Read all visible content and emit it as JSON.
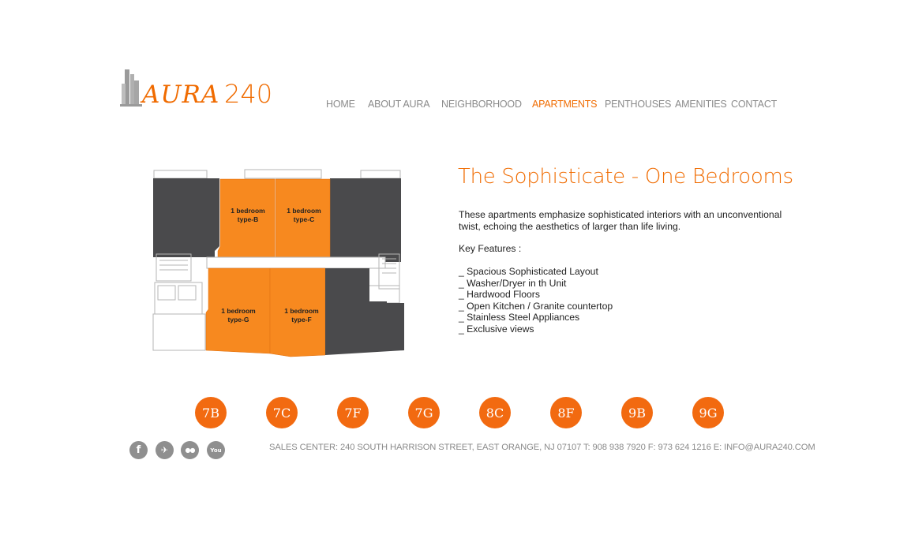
{
  "brand": {
    "logo_word": "AURA",
    "logo_number": "240",
    "accent_color": "#f06b00"
  },
  "nav": {
    "items": [
      {
        "label": "HOME"
      },
      {
        "label": "ABOUT AURA"
      },
      {
        "label": "NEIGHBORHOOD"
      },
      {
        "label": "APARTMENTS",
        "active": true
      },
      {
        "label": "PENTHOUSES"
      },
      {
        "label": "AMENITIES"
      },
      {
        "label": "CONTACT"
      }
    ]
  },
  "floorplan": {
    "units": [
      {
        "line1": "1 bedroom",
        "line2": "type-B"
      },
      {
        "line1": "1 bedroom",
        "line2": "type-C"
      },
      {
        "line1": "1 bedroom",
        "line2": "type-G"
      },
      {
        "line1": "1 bedroom",
        "line2": "type-F"
      }
    ],
    "colors": {
      "highlight": "#f7891f",
      "dark": "#4a4a4c",
      "outline": "#b5b5b5"
    }
  },
  "content": {
    "title": "The Sophisticate - One Bedrooms",
    "description": "These apartments emphasize sophisticated interiors with an unconventional twist, echoing the aesthetics of larger than life living.",
    "features_title": "Key Features :",
    "features": [
      "_ Spacious Sophisticated Layout",
      "_ Washer/Dryer in th Unit",
      "_ Hardwood Floors",
      "_ Open Kitchen / Granite countertop",
      "_ Stainless Steel Appliances",
      "_ Exclusive views"
    ]
  },
  "units": [
    "7B",
    "7C",
    "7F",
    "7G",
    "8C",
    "8F",
    "9B",
    "9G"
  ],
  "socials": [
    {
      "icon": "facebook-icon",
      "glyph": "f"
    },
    {
      "icon": "bird-icon",
      "glyph": "✈"
    },
    {
      "icon": "flickr-icon",
      "glyph": "●●"
    },
    {
      "icon": "youtube-icon",
      "glyph": "You"
    }
  ],
  "footer": {
    "text": "SALES CENTER: 240 SOUTH HARRISON STREET, EAST ORANGE, NJ 07107 T: 908 938 7920 F: 973 624 1216 E: INFO@AURA240.COM"
  }
}
